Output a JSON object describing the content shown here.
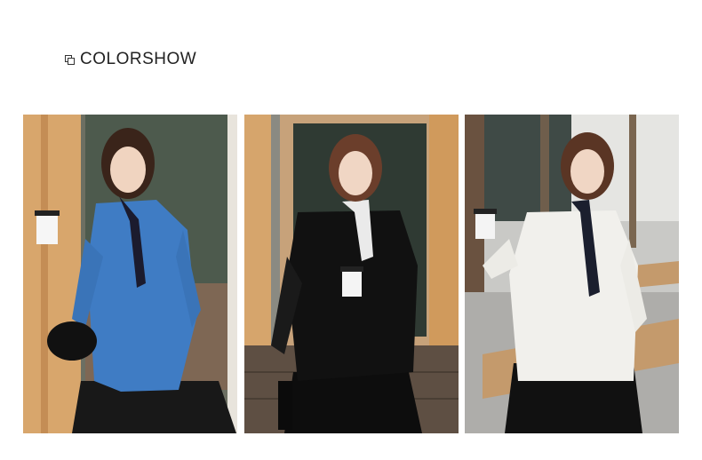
{
  "header": {
    "title": "COLORSHOW",
    "icon": "overlapping-squares-icon"
  },
  "photos": [
    {
      "shirt_color": "#3f7cc4"
    },
    {
      "shirt_color": "#111111"
    },
    {
      "shirt_color": "#f1f0ec"
    }
  ]
}
